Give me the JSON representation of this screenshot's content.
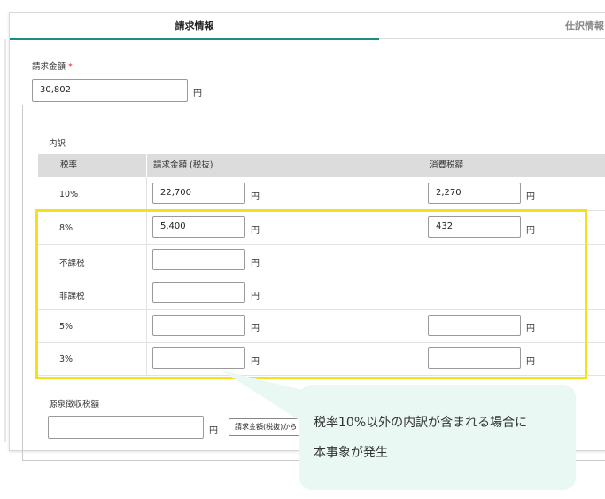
{
  "tabs": {
    "active": "請求情報",
    "inactive": "仕訳情報"
  },
  "invoice_amount": {
    "label": "請求金額",
    "required_mark": "*",
    "value": "30,802",
    "unit": "円"
  },
  "breakdown": {
    "title": "内訳",
    "headers": {
      "rate": "税率",
      "amount": "請求金額 (税抜)",
      "tax": "消費税額"
    },
    "unit": "円",
    "rows": [
      {
        "rate": "10%",
        "amount": "22,700",
        "tax": "2,270"
      },
      {
        "rate": "8%",
        "amount": "5,400",
        "tax": "432"
      },
      {
        "rate": "不課税",
        "amount": "",
        "tax": ""
      },
      {
        "rate": "非課税",
        "amount": "",
        "tax": ""
      },
      {
        "rate": "5%",
        "amount": "",
        "tax": ""
      },
      {
        "rate": "3%",
        "amount": "",
        "tax": ""
      }
    ]
  },
  "withholding": {
    "label": "源泉徴収税額",
    "value": "",
    "unit": "円",
    "button_label": "請求金額(税抜)から"
  },
  "tooltip": {
    "line1": "税率10%以外の内訳が含まれる場合に",
    "line2": "本事象が発生"
  },
  "colors": {
    "accent": "#1a8e86",
    "highlight": "#f5e11a",
    "tooltip_bg": "#e9f8f2",
    "required": "#d23"
  }
}
